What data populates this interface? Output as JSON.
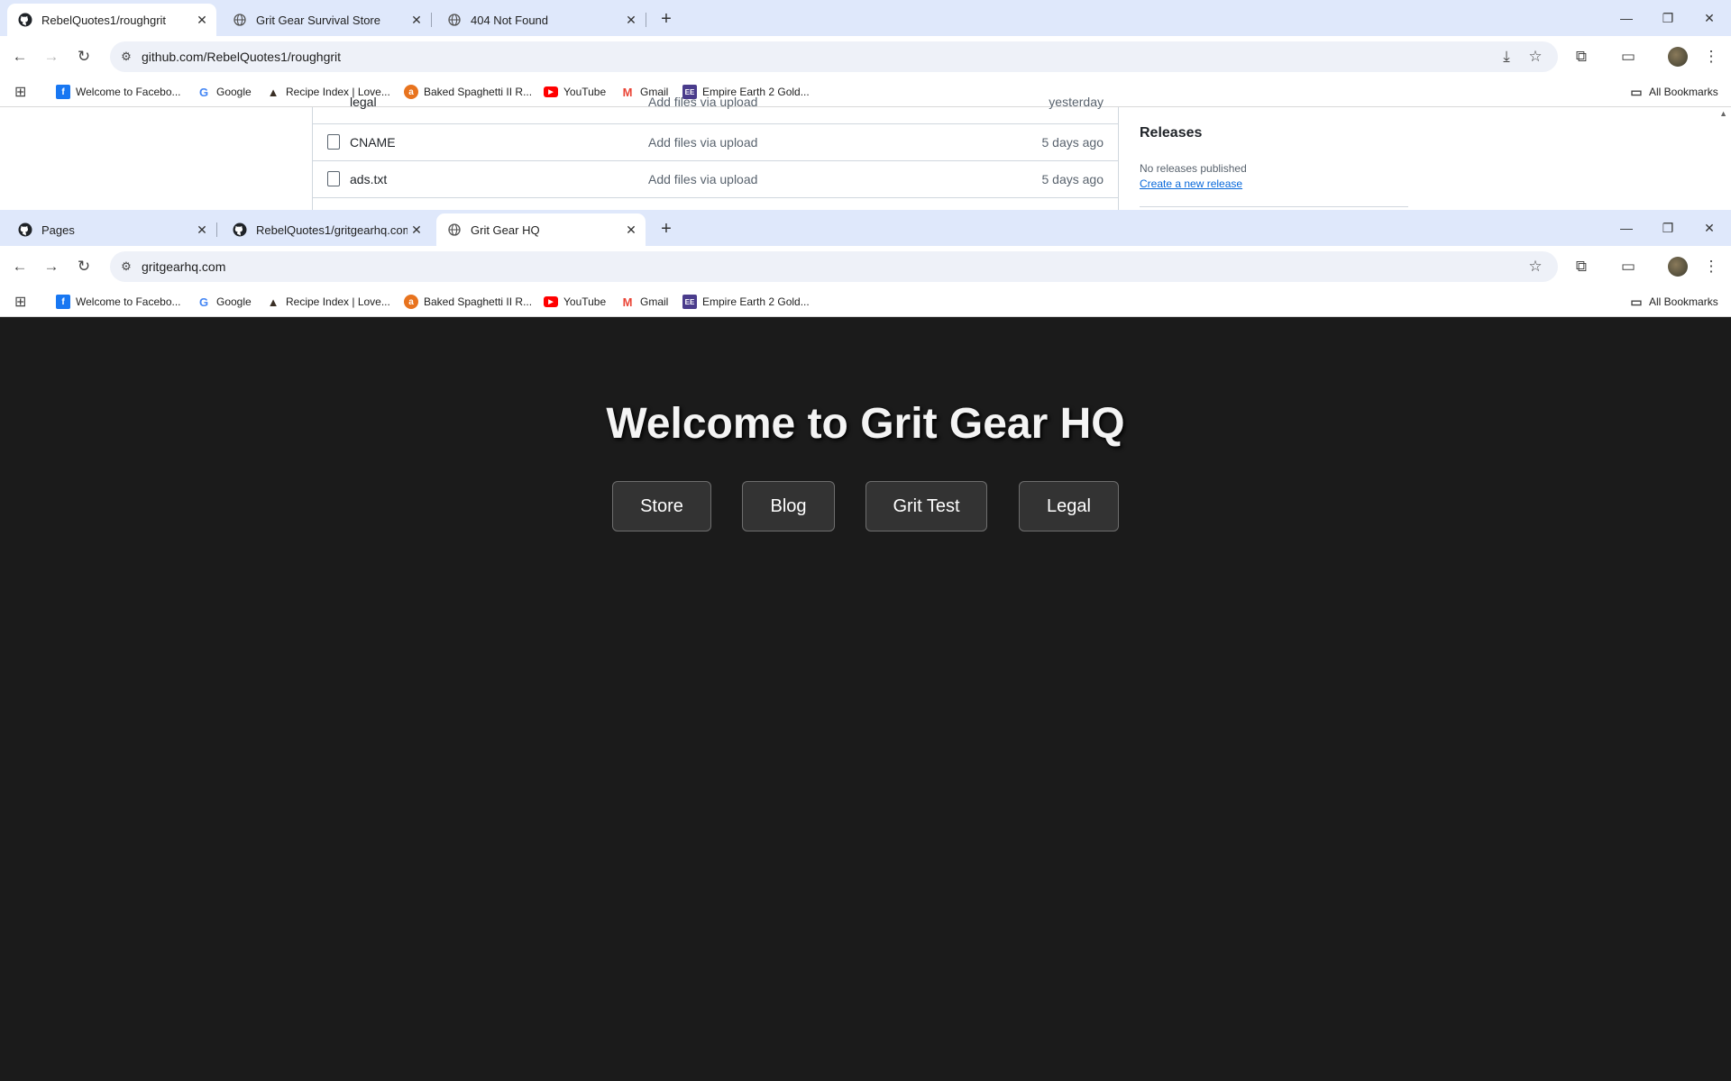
{
  "window1": {
    "tabs": [
      {
        "title": "RebelQuotes1/roughgrit",
        "icon": "github-icon",
        "active": true
      },
      {
        "title": "Grit Gear Survival Store",
        "icon": "globe-icon",
        "active": false
      },
      {
        "title": "404 Not Found",
        "icon": "globe-icon",
        "active": false
      }
    ],
    "url": "github.com/RebelQuotes1/roughgrit",
    "files": [
      {
        "name": "CNAME",
        "message": "Add files via upload",
        "date": "5 days ago"
      },
      {
        "name": "ads.txt",
        "message": "Add files via upload",
        "date": "5 days ago"
      }
    ],
    "sidebar": {
      "releases_title": "Releases",
      "no_releases": "No releases published",
      "create_release": "Create a new release"
    }
  },
  "window2": {
    "tabs": [
      {
        "title": "Pages",
        "icon": "github-icon",
        "active": false
      },
      {
        "title": "RebelQuotes1/gritgearhq.com",
        "icon": "github-icon",
        "active": false
      },
      {
        "title": "Grit Gear HQ",
        "icon": "globe-icon",
        "active": true
      }
    ],
    "url": "gritgearhq.com"
  },
  "bookmarks": [
    {
      "label": "Welcome to Facebo...",
      "icon": "facebook-icon",
      "color": "#1877f2"
    },
    {
      "label": "Google",
      "icon": "google-icon",
      "color": "#4285f4"
    },
    {
      "label": "Recipe Index | Love...",
      "icon": "recipe-icon",
      "color": "#3a2f25"
    },
    {
      "label": "Baked Spaghetti II R...",
      "icon": "allrecipes-icon",
      "color": "#e8731e"
    },
    {
      "label": "YouTube",
      "icon": "youtube-icon",
      "color": "#ff0000"
    },
    {
      "label": "Gmail",
      "icon": "gmail-icon",
      "color": "#ea4335"
    },
    {
      "label": "Empire Earth 2 Gold...",
      "icon": "game-icon",
      "color": "#4a3c8c"
    }
  ],
  "all_bookmarks": "All Bookmarks",
  "site": {
    "heading": "Welcome to Grit Gear HQ",
    "buttons": [
      "Store",
      "Blog",
      "Grit Test",
      "Legal"
    ]
  }
}
